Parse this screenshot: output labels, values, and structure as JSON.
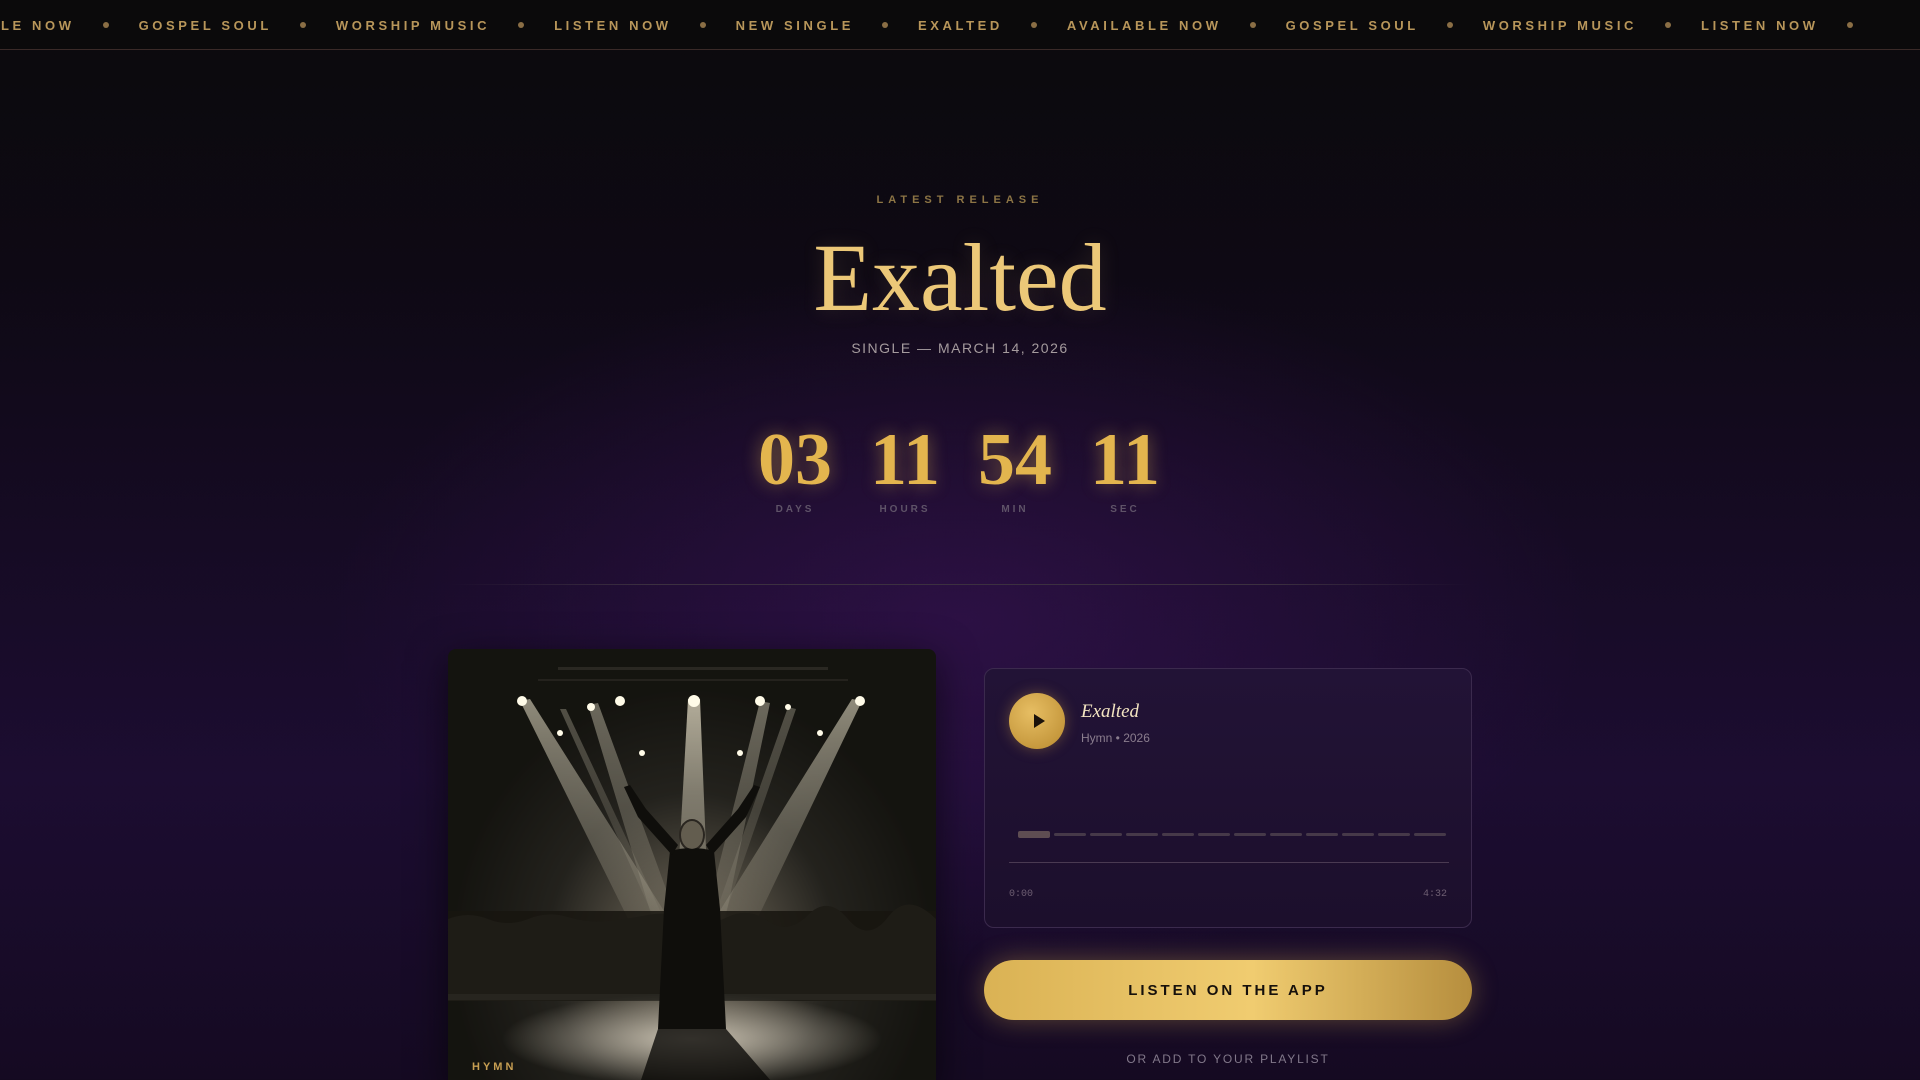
{
  "marquee": {
    "items": [
      "BLE NOW",
      "GOSPEL SOUL",
      "WORSHIP MUSIC",
      "LISTEN NOW",
      "NEW SINGLE",
      "EXALTED",
      "AVAILABLE NOW",
      "GOSPEL SOUL",
      "WORSHIP MUSIC",
      "LISTEN NOW"
    ]
  },
  "hero": {
    "eyebrow": "LATEST RELEASE",
    "title": "Exalted",
    "subtitle": "SINGLE — MARCH 14, 2026"
  },
  "countdown": [
    {
      "value": "03",
      "label": "DAYS"
    },
    {
      "value": "11",
      "label": "HOURS"
    },
    {
      "value": "54",
      "label": "MIN"
    },
    {
      "value": "11",
      "label": "SEC"
    }
  ],
  "album": {
    "label": "HYMN"
  },
  "player": {
    "title": "Exalted",
    "meta": "Hymn • 2026",
    "time_start": "0:00",
    "time_end": "4:32",
    "progress": 0,
    "play_icon": "play-icon"
  },
  "cta": {
    "label": "LISTEN ON THE APP",
    "secondary": "OR ADD TO YOUR PLAYLIST"
  },
  "colors": {
    "accent": "#e3b54e",
    "background": "#160b24"
  }
}
